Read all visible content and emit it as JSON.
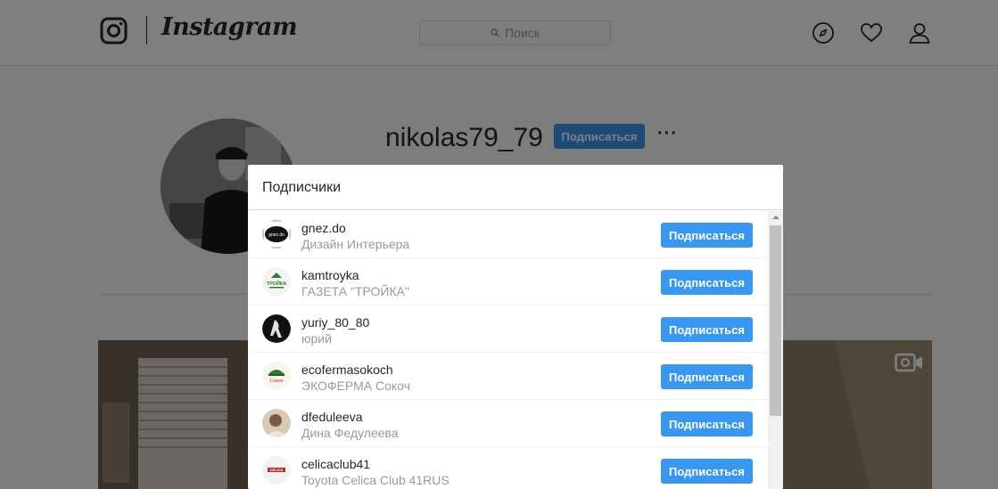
{
  "header": {
    "brand": "Instagram",
    "search_placeholder": "Поиск",
    "icons": [
      "instagram-logo-icon",
      "compass-icon",
      "heart-icon",
      "user-icon"
    ]
  },
  "profile": {
    "username": "nikolas79_79",
    "follow_label": "Подписаться",
    "more_label": "···"
  },
  "modal": {
    "title": "Подписчики",
    "follow_label": "Подписаться",
    "items": [
      {
        "username": "gnez.do",
        "name": "Дизайн Интерьера",
        "avatar_text": "gnez.do"
      },
      {
        "username": "kamtroyka",
        "name": "ГАЗЕТА \"ТРОЙКА\"",
        "avatar_text": "ТРОЙКА"
      },
      {
        "username": "yuriy_80_80",
        "name": "юрий",
        "avatar_text": ""
      },
      {
        "username": "ecofermasokoch",
        "name": "ЭКОФЕРМА Сокоч",
        "avatar_text": "Сокоч"
      },
      {
        "username": "dfeduleeva",
        "name": "Дина Федулеева",
        "avatar_text": ""
      },
      {
        "username": "celicaclub41",
        "name": "Toyota Celica Club 41RUS",
        "avatar_text": "CELICA"
      }
    ]
  },
  "colors": {
    "accent": "#3897f0",
    "overlay": "rgba(0,0,0,0.5)"
  }
}
